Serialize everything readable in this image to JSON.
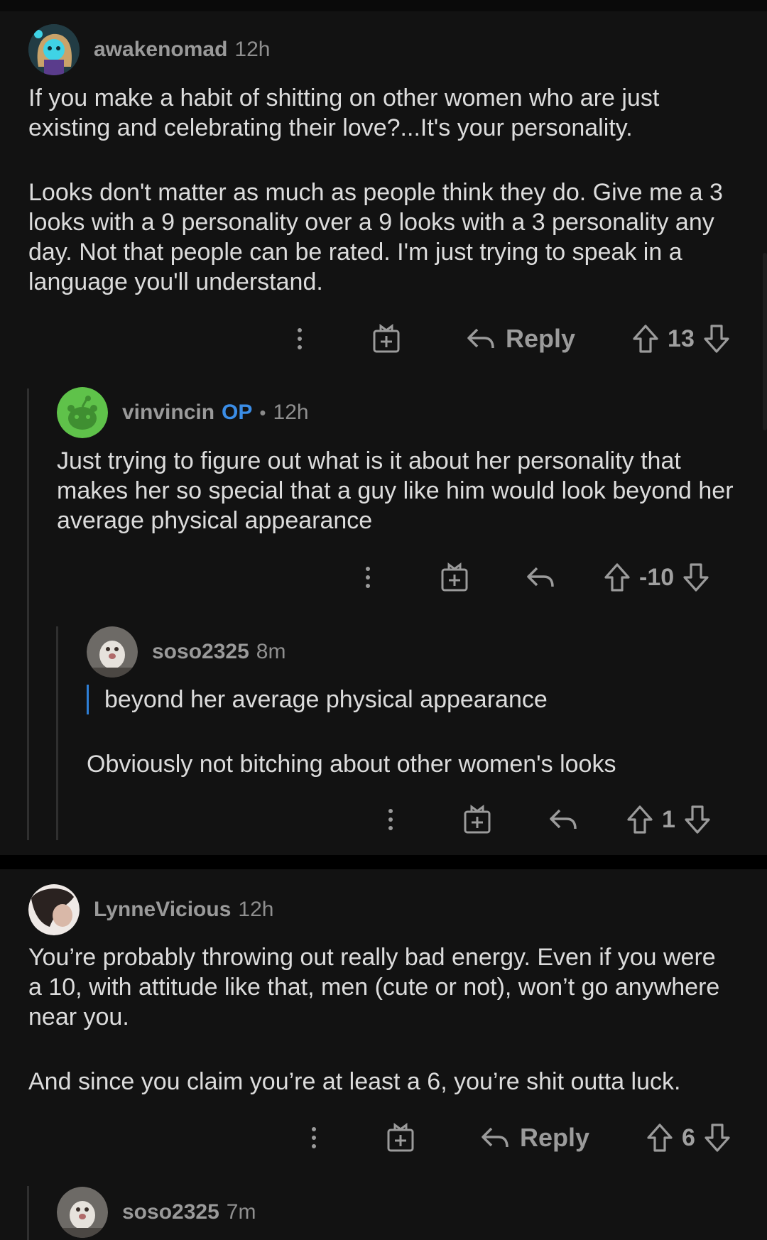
{
  "comments": [
    {
      "username": "awakenomad",
      "time": "12h",
      "paragraphs": [
        "If you make a habit of shitting on other women who are just existing and celebrating their love?...It's your personality.",
        "Looks don't matter as much as people think they do. Give me a 3 looks with a 9 personality over a 9 looks with a 3 personality any day. Not that people can be rated. I'm just trying to speak in a language you'll understand."
      ],
      "reply_label": "Reply",
      "score": "13"
    },
    {
      "username": "vinvincin",
      "op_badge": "OP",
      "dot": "•",
      "time": "12h",
      "paragraphs": [
        "Just trying to figure out what is it about her personality that makes her so special that a guy like him would look beyond her average physical appearance"
      ],
      "score": "-10"
    },
    {
      "username": "soso2325",
      "time": "8m",
      "quote": "beyond her average physical appearance",
      "paragraphs": [
        "Obviously not bitching about other women's looks"
      ],
      "score": "1"
    },
    {
      "username": "LynneVicious",
      "time": "12h",
      "paragraphs": [
        "You’re probably throwing out really bad energy. Even if you were a 10, with attitude like that, men (cute or not), won’t go anywhere near you.",
        "And since you claim you’re at least a 6, you’re shit outta luck."
      ],
      "reply_label": "Reply",
      "score": "6"
    },
    {
      "username": "soso2325",
      "time": "7m"
    }
  ],
  "icons": {
    "more": "more-options-icon",
    "award": "award-icon",
    "reply": "reply-icon",
    "upvote": "upvote-icon",
    "downvote": "downvote-icon"
  },
  "colors": {
    "background": "#121212",
    "op_badge": "#3b8de6",
    "quote_bar": "#2e7fd6",
    "text": "#dcdcdc",
    "meta": "#9a9a9a"
  }
}
